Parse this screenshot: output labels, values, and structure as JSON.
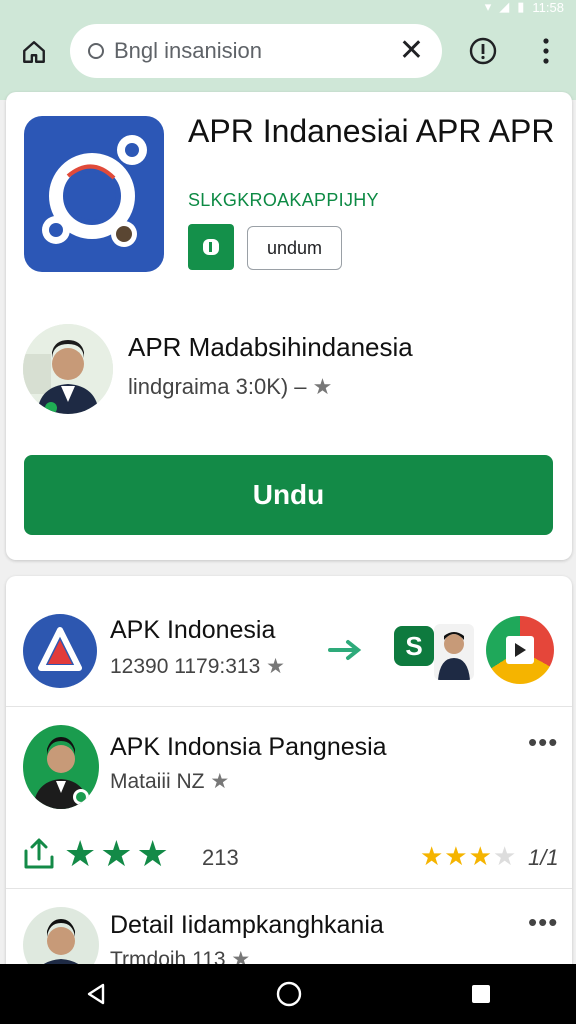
{
  "status_bar": {
    "time": "11:58"
  },
  "browser": {
    "url_value": "Bngl insanision",
    "clear_label": "✕"
  },
  "app": {
    "title": "APR Indanesiai APR APR",
    "subtitle": "SLKGKROAKAPPIJHY",
    "chip_label": "undum",
    "developer_name": "APR Madabsihindanesia",
    "developer_meta": "lindgraima 3:0K) –",
    "download_label": "Undu"
  },
  "list": [
    {
      "title": "APK Indonesia",
      "meta": "12390 1179:313"
    },
    {
      "title": "APK Indonsia Pangnesia",
      "meta": "Mataiii NZ",
      "rating_count": "213",
      "right_text": "1/1"
    },
    {
      "title": "Detail Iidampkanghkania",
      "meta": "Trmdoih 113"
    }
  ],
  "colors": {
    "chrome_bg": "#cfe7d7",
    "accent_green": "#138a47",
    "app_icon_blue": "#2c57b6",
    "star_gold": "#f5b400"
  }
}
